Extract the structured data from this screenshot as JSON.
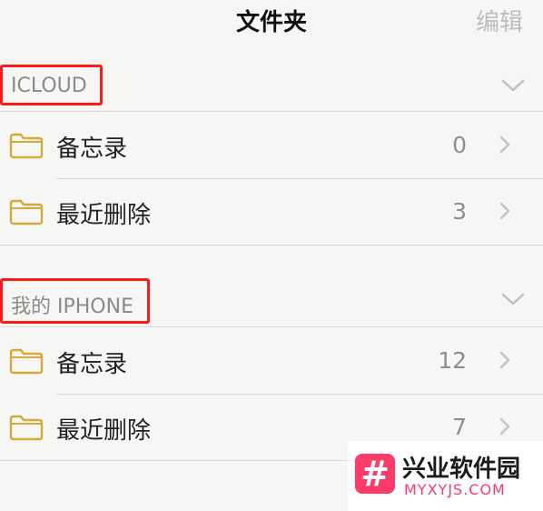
{
  "nav": {
    "title": "文件夹",
    "edit_label": "编辑"
  },
  "sections": [
    {
      "title": "ICLOUD",
      "rows": [
        {
          "label": "备忘录",
          "count": "0"
        },
        {
          "label": "最近删除",
          "count": "3"
        }
      ]
    },
    {
      "title": "我的 IPHONE",
      "rows": [
        {
          "label": "备忘录",
          "count": "12"
        },
        {
          "label": "最近删除",
          "count": "7"
        }
      ]
    }
  ],
  "watermark": {
    "symbol": "#",
    "text": "兴业软件园",
    "domain": "MYXYJS.COM"
  },
  "colors": {
    "folder": "#d6aa3a",
    "highlight": "#ff1a1a",
    "watermark_accent": "#ff3b6a"
  }
}
